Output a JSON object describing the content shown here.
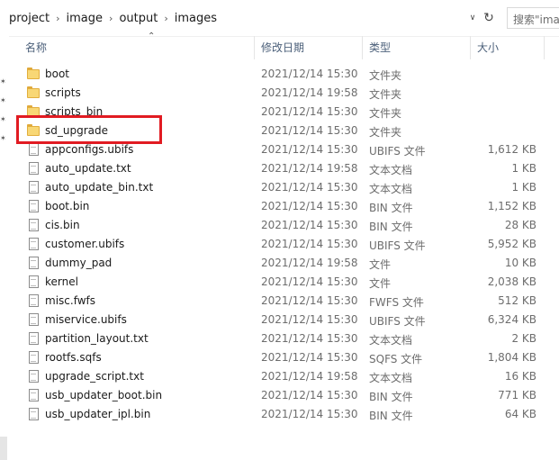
{
  "address": {
    "crumbs": [
      "project",
      "image",
      "output",
      "images"
    ],
    "search_placeholder": "搜索\"ima"
  },
  "columns": {
    "name": "名称",
    "date": "修改日期",
    "type": "类型",
    "size": "大小"
  },
  "files": [
    {
      "name": "boot",
      "date": "2021/12/14 15:30",
      "type": "文件夹",
      "size": "",
      "kind": "folder"
    },
    {
      "name": "scripts",
      "date": "2021/12/14 19:58",
      "type": "文件夹",
      "size": "",
      "kind": "folder"
    },
    {
      "name": "scripts_bin",
      "date": "2021/12/14 15:30",
      "type": "文件夹",
      "size": "",
      "kind": "folder"
    },
    {
      "name": "sd_upgrade",
      "date": "2021/12/14 15:30",
      "type": "文件夹",
      "size": "",
      "kind": "folder"
    },
    {
      "name": "appconfigs.ubifs",
      "date": "2021/12/14 15:30",
      "type": "UBIFS 文件",
      "size": "1,612 KB",
      "kind": "file"
    },
    {
      "name": "auto_update.txt",
      "date": "2021/12/14 19:58",
      "type": "文本文档",
      "size": "1 KB",
      "kind": "file"
    },
    {
      "name": "auto_update_bin.txt",
      "date": "2021/12/14 15:30",
      "type": "文本文档",
      "size": "1 KB",
      "kind": "file"
    },
    {
      "name": "boot.bin",
      "date": "2021/12/14 15:30",
      "type": "BIN 文件",
      "size": "1,152 KB",
      "kind": "file"
    },
    {
      "name": "cis.bin",
      "date": "2021/12/14 15:30",
      "type": "BIN 文件",
      "size": "28 KB",
      "kind": "file"
    },
    {
      "name": "customer.ubifs",
      "date": "2021/12/14 15:30",
      "type": "UBIFS 文件",
      "size": "5,952 KB",
      "kind": "file"
    },
    {
      "name": "dummy_pad",
      "date": "2021/12/14 19:58",
      "type": "文件",
      "size": "10 KB",
      "kind": "file"
    },
    {
      "name": "kernel",
      "date": "2021/12/14 15:30",
      "type": "文件",
      "size": "2,038 KB",
      "kind": "file"
    },
    {
      "name": "misc.fwfs",
      "date": "2021/12/14 15:30",
      "type": "FWFS 文件",
      "size": "512 KB",
      "kind": "file"
    },
    {
      "name": "miservice.ubifs",
      "date": "2021/12/14 15:30",
      "type": "UBIFS 文件",
      "size": "6,324 KB",
      "kind": "file"
    },
    {
      "name": "partition_layout.txt",
      "date": "2021/12/14 15:30",
      "type": "文本文档",
      "size": "2 KB",
      "kind": "file"
    },
    {
      "name": "rootfs.sqfs",
      "date": "2021/12/14 15:30",
      "type": "SQFS 文件",
      "size": "1,804 KB",
      "kind": "file"
    },
    {
      "name": "upgrade_script.txt",
      "date": "2021/12/14 19:58",
      "type": "文本文档",
      "size": "16 KB",
      "kind": "file"
    },
    {
      "name": "usb_updater_boot.bin",
      "date": "2021/12/14 15:30",
      "type": "BIN 文件",
      "size": "771 KB",
      "kind": "file"
    },
    {
      "name": "usb_updater_ipl.bin",
      "date": "2021/12/14 15:30",
      "type": "BIN 文件",
      "size": "64 KB",
      "kind": "file"
    }
  ],
  "colors": {
    "highlight": "#e11b22",
    "folder": "#f8d775",
    "header_text": "#4c607a"
  }
}
